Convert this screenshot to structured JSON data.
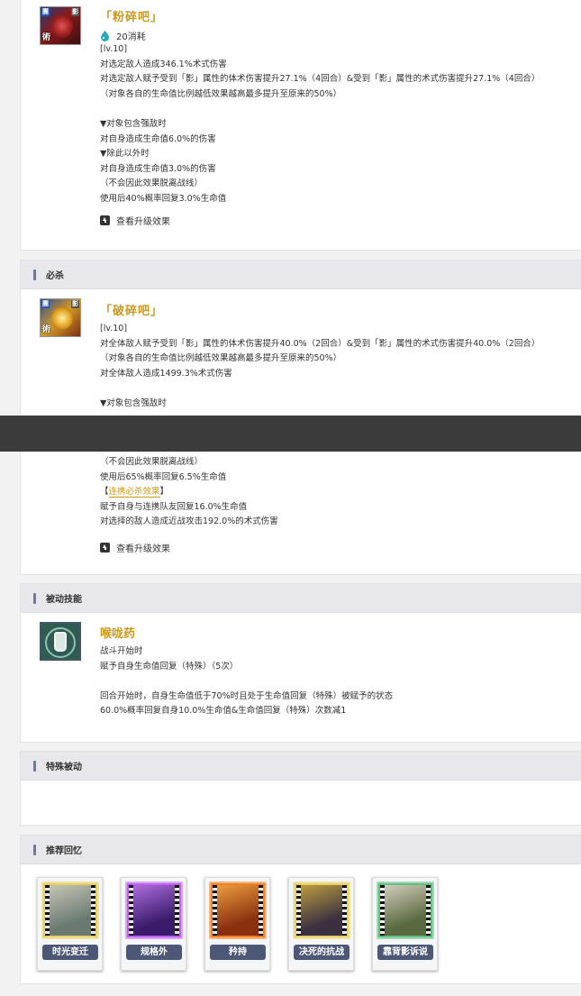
{
  "skill1": {
    "name": "「粉碎吧」",
    "cost": "20消耗",
    "icon_badges": [
      "團",
      "影"
    ],
    "icon_tag": "術",
    "lines": [
      "[lv.10]",
      "对选定敌人造成346.1%术式伤害",
      "对选定敌人赋予受到「影」属性的体术伤害提升27.1%（4回合）&受到「影」属性的术式伤害提升27.1%（4回合）",
      "（对象各自的生命值比例越低效果越高最多提升至原来的50%）",
      "",
      "▼对象包含强敌时",
      "对自身造成生命值6.0%的伤害",
      "▼除此以外时",
      "对自身造成生命值3.0%的伤害",
      "（不会因此效果脱离战线）",
      "使用后40%概率回复3.0%生命值"
    ],
    "upgrade": "查看升级效果"
  },
  "ultimate_section": {
    "title": "必杀"
  },
  "skill2": {
    "name": "「破碎吧」",
    "icon_badges": [
      "團",
      "影"
    ],
    "icon_tag": "術",
    "lines_top": [
      "[lv.10]",
      "对全体敌人赋予受到「影」属性的体术伤害提升40.0%（2回合）&受到「影」属性的术式伤害提升40.0%（2回合）",
      "（对象各自的生命值比例越低效果越高最多提升至原来的50%）",
      "对全体敌人造成1499.3%术式伤害",
      "",
      "▼对象包含强敌时"
    ],
    "lines_bottom_pre": [
      "（不会因此效果脱离战线）",
      "使用后65%概率回复6.5%生命值"
    ],
    "combo_open": "【",
    "combo_label": "连携必杀效果",
    "combo_close": "】",
    "lines_bottom_post": [
      "赋予自身与连携队友回复16.0%生命值",
      "对选择的敌人造成近战攻击192.0%的术式伤害"
    ],
    "upgrade": "查看升级效果"
  },
  "passive_section": {
    "title": "被动技能"
  },
  "passive": {
    "name": "喉咙药",
    "lines": [
      "战斗开始时",
      "赋予自身生命值回复（特殊）（5次）",
      "",
      "回合开始时，自身生命值低于70%时且处于生命值回复（特殊）被赋予的状态",
      "60.0%概率回复自身10.0%生命值&生命值回复（特殊）次数减1"
    ]
  },
  "special_passive_section": {
    "title": "特殊被动"
  },
  "memories_section": {
    "title": "推荐回忆"
  },
  "memories": [
    {
      "name": "时光变迁",
      "colors": [
        "#6a7a70",
        "#c8c8b8",
        "#e8d060"
      ]
    },
    {
      "name": "规格外",
      "colors": [
        "#3a1a6a",
        "#b070e0",
        "#c060f0"
      ]
    },
    {
      "name": "矜持",
      "colors": [
        "#8a3010",
        "#f0a040",
        "#f08020"
      ]
    },
    {
      "name": "决死的抗战",
      "colors": [
        "#3a3040",
        "#c0a040",
        "#e8d060"
      ]
    },
    {
      "name": "靠背影诉说",
      "colors": [
        "#5a6a40",
        "#d8d0c0",
        "#60c080"
      ]
    }
  ]
}
